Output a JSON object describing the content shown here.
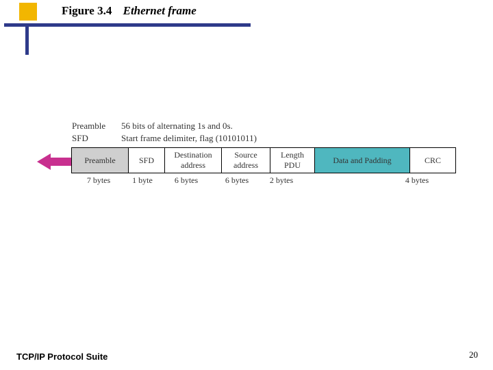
{
  "title": {
    "label": "Figure 3.4",
    "caption": "Ethernet frame"
  },
  "defs": [
    {
      "term": "Preamble",
      "desc": "56 bits of alternating 1s and 0s."
    },
    {
      "term": "SFD",
      "desc": "Start frame delimiter, flag (10101011)"
    }
  ],
  "frame": {
    "fields": [
      {
        "name": "Preamble",
        "bytes": "7 bytes"
      },
      {
        "name": "SFD",
        "bytes": "1 byte"
      },
      {
        "name": "Destination address",
        "bytes": "6 bytes"
      },
      {
        "name": "Source address",
        "bytes": "6 bytes"
      },
      {
        "name": "Length PDU",
        "bytes": "2 bytes"
      },
      {
        "name": "Data and Padding",
        "bytes": ""
      },
      {
        "name": "CRC",
        "bytes": "4 bytes"
      }
    ]
  },
  "footer": {
    "left": "TCP/IP Protocol Suite",
    "page": "20"
  },
  "colors": {
    "accent_yellow": "#f2b600",
    "accent_blue": "#2e3a8a",
    "data_fill": "#4fb7bf",
    "arrow": "#c8308f"
  }
}
